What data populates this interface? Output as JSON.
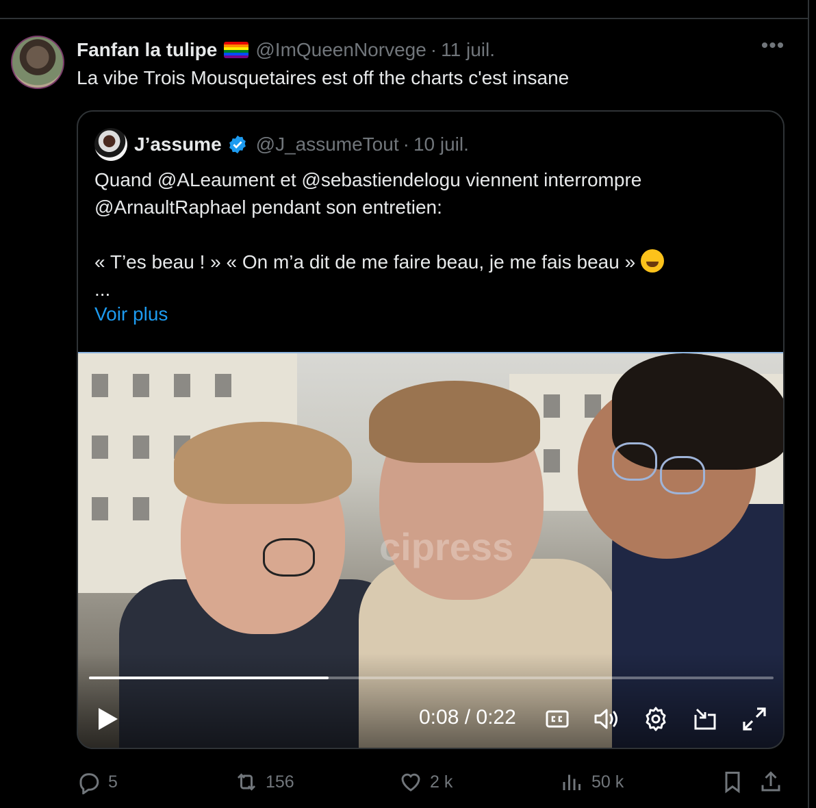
{
  "tweet": {
    "author_name": "Fanfan la tulipe",
    "handle": "@ImQueenNorvege",
    "separator": "·",
    "date": "11 juil.",
    "more_label": "•••",
    "text": "La vibe Trois Mousquetaires est off the charts c'est insane"
  },
  "quote": {
    "author_name": "J’assume",
    "handle": "@J_assumeTout",
    "separator": "·",
    "date": "10 juil.",
    "line1": "Quand @ALeaument et @sebastiendelogu viennent interrompre",
    "line2": "@ArnaultRaphael pendant son entretien:",
    "line3": "« T’es beau ! » « On m’a dit de me faire beau, je me fais beau »",
    "ellipsis": "...",
    "see_more": "Voir plus"
  },
  "video": {
    "watermark": "cipress",
    "timecode": "0:08 / 0:22",
    "progress": 0.35
  },
  "actions": {
    "replies": "5",
    "reposts": "156",
    "likes": "2 k",
    "views": "50 k"
  },
  "colors": {
    "background": "#000000",
    "text": "#e7e9ea",
    "muted": "#71767b",
    "link": "#1d9bf0",
    "border": "#2f3336",
    "verified": "#1d9bf0"
  },
  "icons": [
    "more-icon",
    "rainbow-flag-icon",
    "verified-badge-icon",
    "sweat-smile-emoji",
    "play-icon",
    "captions-icon",
    "volume-icon",
    "settings-icon",
    "picture-in-picture-icon",
    "fullscreen-icon",
    "reply-icon",
    "repost-icon",
    "like-icon",
    "views-icon",
    "bookmark-icon",
    "share-icon"
  ]
}
